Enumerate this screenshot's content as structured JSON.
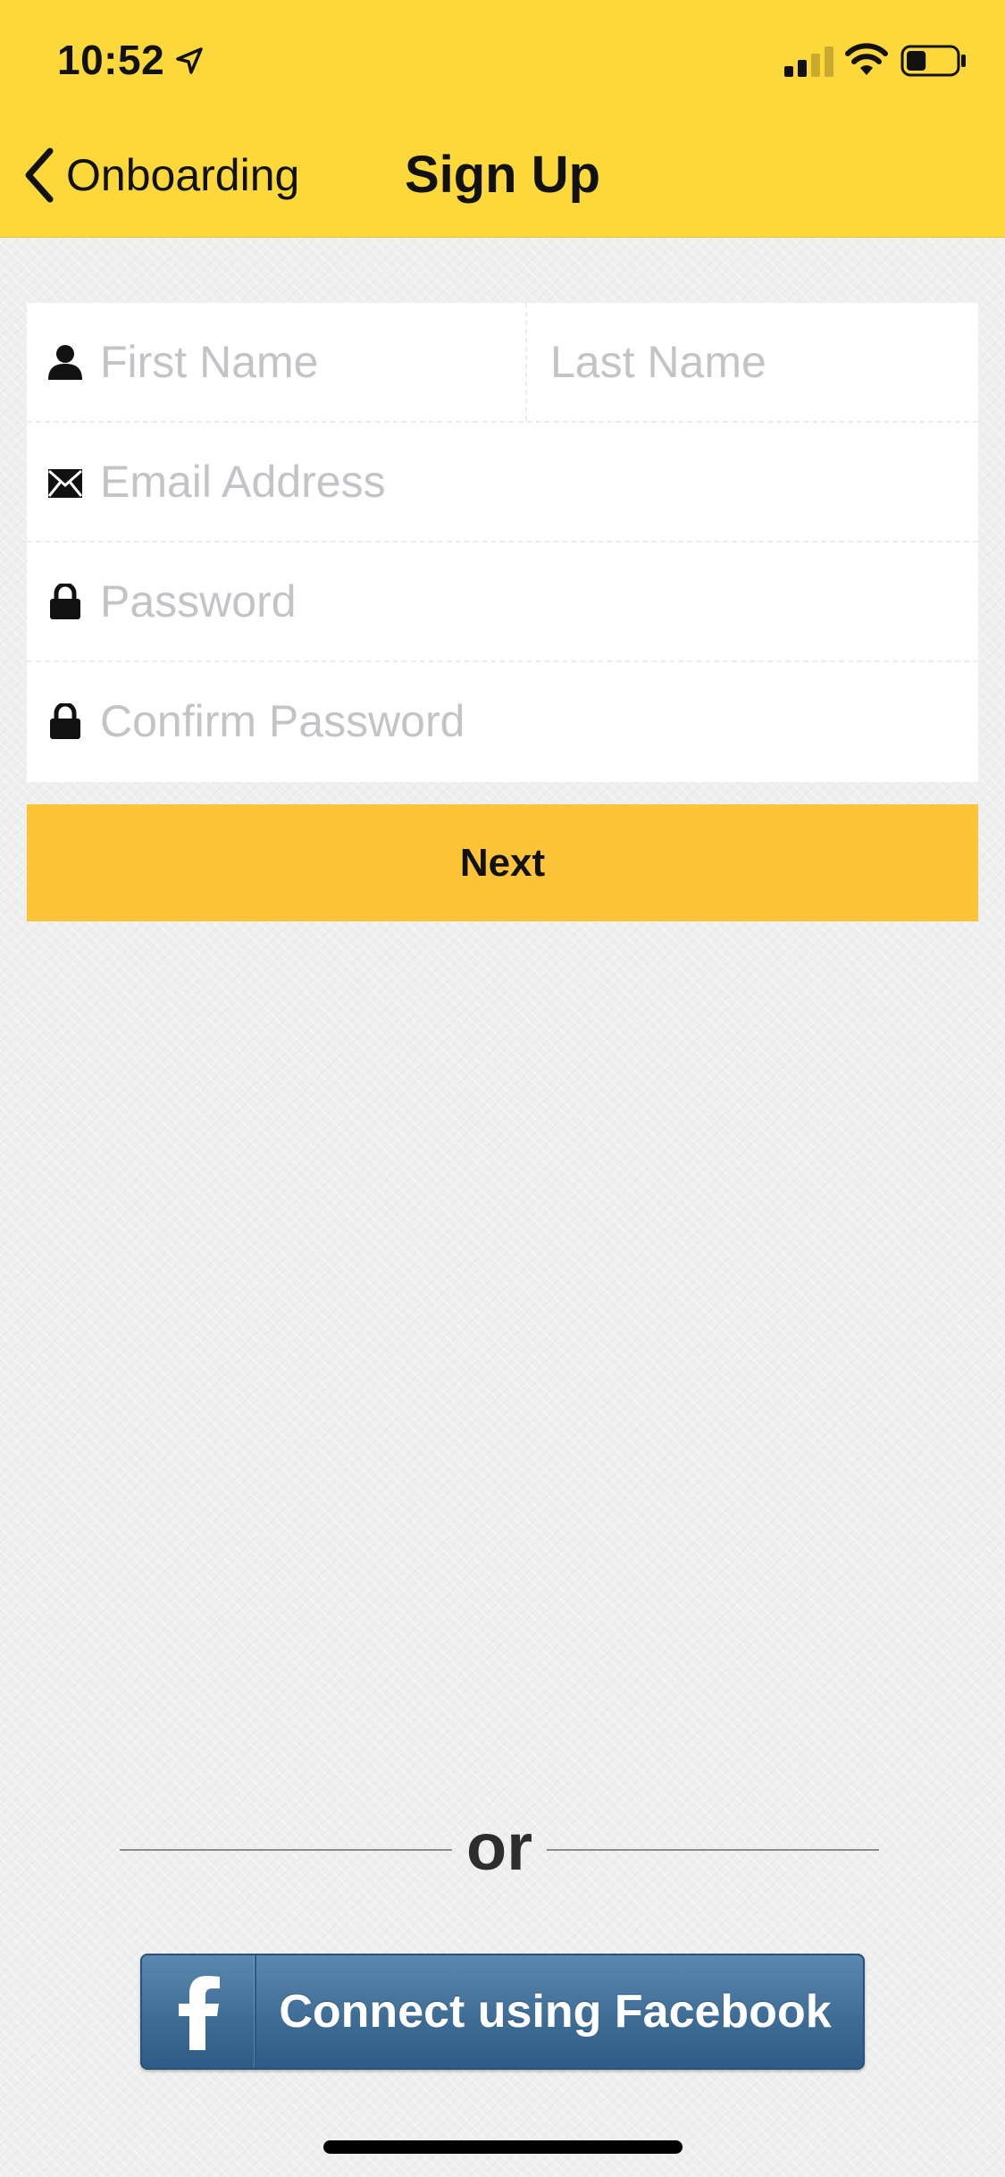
{
  "status_bar": {
    "time": "10:52",
    "location_icon": "location-arrow-icon",
    "signal_icon": "cellular-signal-icon",
    "wifi_icon": "wifi-icon",
    "battery_icon": "battery-icon",
    "battery_level": 0.4
  },
  "nav": {
    "back_label": "Onboarding",
    "back_icon": "chevron-left-icon",
    "title": "Sign Up"
  },
  "form": {
    "first_name": {
      "placeholder": "First Name",
      "value": "",
      "icon": "person-icon"
    },
    "last_name": {
      "placeholder": "Last Name",
      "value": ""
    },
    "email": {
      "placeholder": "Email Address",
      "value": "",
      "icon": "envelope-icon"
    },
    "password": {
      "placeholder": "Password",
      "value": "",
      "icon": "lock-icon"
    },
    "confirm_password": {
      "placeholder": "Confirm Password",
      "value": "",
      "icon": "lock-icon"
    }
  },
  "next_button": {
    "label": "Next"
  },
  "divider": {
    "text": "or"
  },
  "facebook_button": {
    "label": "Connect using Facebook",
    "icon": "facebook-icon"
  },
  "colors": {
    "header": "#fdd83a",
    "next_button": "#fdc437",
    "facebook": "#3e6d96",
    "placeholder": "#c4c4c8"
  }
}
